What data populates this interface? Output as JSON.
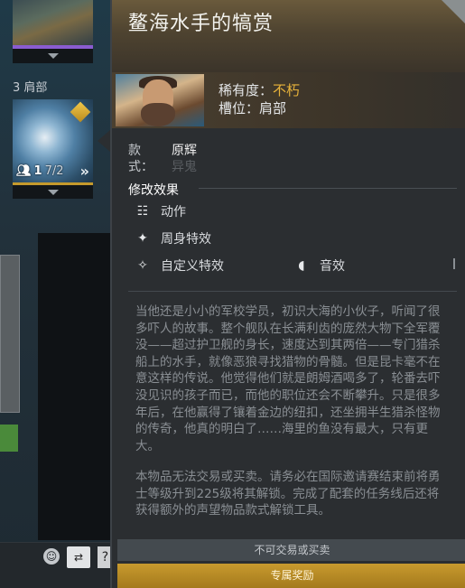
{
  "inventory": {
    "slot_label": "3 肩部",
    "counter_main": "1",
    "counter_sub": "7/2",
    "card_more": "»"
  },
  "tooltip": {
    "title": "鳌海水手的犒赏",
    "rarity_label": "稀有度：",
    "rarity_value": "不朽",
    "slot_text": "槽位：肩部",
    "style_label": "款式：",
    "style_value": "原辉",
    "style_value_alt": "异鬼",
    "modifiers_heading": "修改效果",
    "modifiers": {
      "animation": "动作",
      "ambient": "周身特效",
      "custom_effects": "自定义特效",
      "sound": "音效"
    },
    "lore": "当他还是小小的军校学员，初识大海的小伙子，听闻了很多吓人的故事。整个舰队在长满利齿的庞然大物下全军覆没——超过护卫舰的身长，速度达到其两倍——专门猎杀船上的水手，就像恶狼寻找猎物的骨髓。但是昆卡毫不在意这样的传说。他觉得他们就是朗姆酒喝多了，轮番去吓没见识的孩子而已，而他的职位还会不断攀升。只是很多年后，在他赢得了镶着金边的纽扣，还坐拥半生猎杀怪物的传奇，他真的明白了……海里的鱼没有最大，只有更大。",
    "lock_note": "本物品无法交易或买卖。请务必在国际邀请赛结束前将勇士等级升到225级将其解锁。完成了配套的任务线后还将获得额外的声望物品款式解锁工具。",
    "trade_bar": "不可交易或买卖",
    "exclusive_bar": "专属奖励"
  },
  "icons": {
    "card_down": "chevron-down-icon",
    "counter": "people-icon",
    "animation": "walking-figure-icon",
    "ambient": "sparkles-icon",
    "custom": "magic-wand-icon",
    "sound": "speaker-icon",
    "chat": "smiley-icon",
    "swap": "swap-icon"
  },
  "bottom": {
    "help": "?"
  },
  "colors": {
    "rarity_gold": "#e8b33a",
    "exclusive_bar": "#c89a2e",
    "rare_purple": "#8a5cd0"
  }
}
